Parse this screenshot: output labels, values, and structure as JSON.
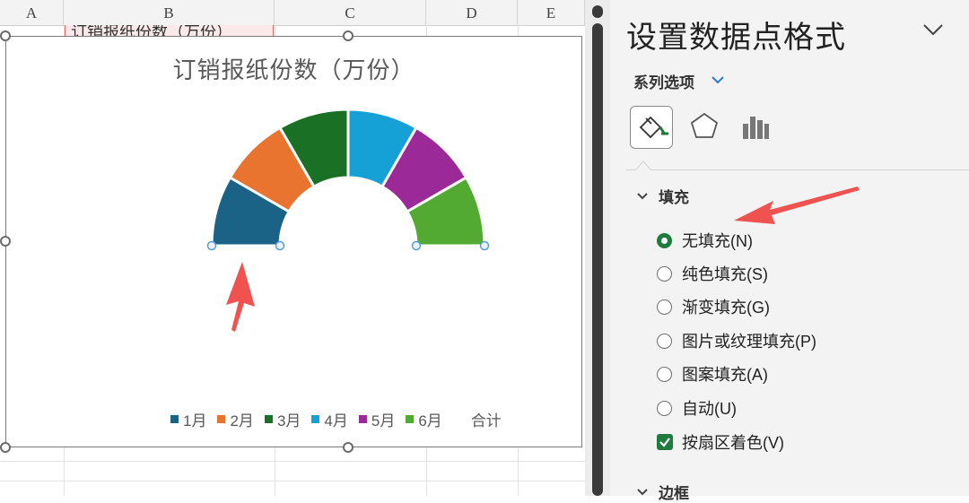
{
  "spreadsheet": {
    "columns": [
      "A",
      "B",
      "C",
      "D",
      "E"
    ],
    "cell_b1_text": "订销报纸份数（万份）"
  },
  "chart_data": {
    "type": "pie",
    "title": "订销报纸份数（万份）",
    "style": "half-doughnut",
    "categories": [
      "1月",
      "2月",
      "3月",
      "4月",
      "5月",
      "6月",
      "合计"
    ],
    "series": [
      {
        "values": [
          1,
          1,
          1,
          1,
          1,
          1
        ],
        "colors": [
          "#1b6386",
          "#e8742f",
          "#1a7024",
          "#15a1d6",
          "#9b2a98",
          "#52aa33"
        ]
      }
    ],
    "total_slice": "合计 (no fill)",
    "legend_position": "bottom"
  },
  "legend": {
    "items": [
      {
        "label": "1月",
        "color": "#1b6386"
      },
      {
        "label": "2月",
        "color": "#e8742f"
      },
      {
        "label": "3月",
        "color": "#1a7024"
      },
      {
        "label": "4月",
        "color": "#15a1d6"
      },
      {
        "label": "5月",
        "color": "#9b2a98"
      },
      {
        "label": "6月",
        "color": "#52aa33"
      }
    ],
    "total_label": "合计"
  },
  "pane": {
    "title": "设置数据点格式",
    "series_options_label": "系列选项",
    "tabs": [
      "fill-line-icon",
      "effects-icon",
      "series-options-icon"
    ],
    "fill_section": {
      "label": "填充",
      "options": [
        {
          "label": "无填充(N)",
          "selected": true
        },
        {
          "label": "纯色填充(S)",
          "selected": false
        },
        {
          "label": "渐变填充(G)",
          "selected": false
        },
        {
          "label": "图片或纹理填充(P)",
          "selected": false
        },
        {
          "label": "图案填充(A)",
          "selected": false
        },
        {
          "label": "自动(U)",
          "selected": false
        }
      ],
      "vary_colors_label": "按扇区着色(V)",
      "vary_colors_checked": true
    },
    "border_section": {
      "label": "边框"
    }
  },
  "colors": {
    "accent_green": "#1f7a3d",
    "annotation_red": "#f0534f"
  }
}
